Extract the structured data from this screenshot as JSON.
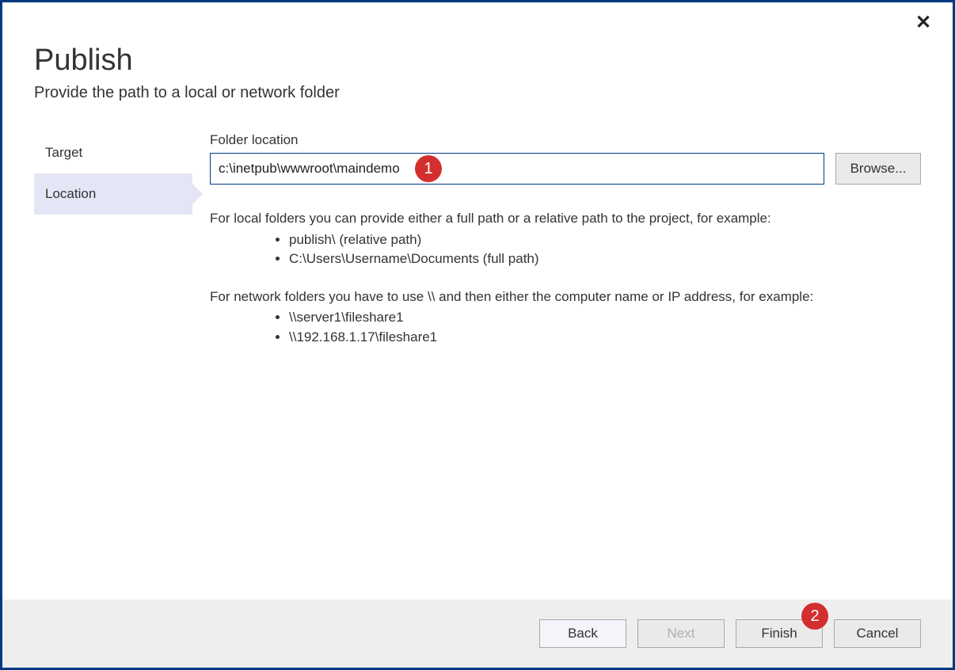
{
  "window": {
    "title": "Publish",
    "subtitle": "Provide the path to a local or network folder",
    "close_label": "✕"
  },
  "sidebar": {
    "items": [
      {
        "label": "Target",
        "selected": false
      },
      {
        "label": "Location",
        "selected": true
      }
    ]
  },
  "form": {
    "folder_label": "Folder location",
    "folder_value": "c:\\inetpub\\wwwroot\\maindemo",
    "browse_label": "Browse..."
  },
  "help": {
    "local_intro": "For local folders you can provide either a full path or a relative path to the project, for example:",
    "local_examples": [
      "publish\\ (relative path)",
      "C:\\Users\\Username\\Documents (full path)"
    ],
    "network_intro": "For network folders you have to use \\\\ and then either the computer name or IP address, for example:",
    "network_examples": [
      "\\\\server1\\fileshare1",
      "\\\\192.168.1.17\\fileshare1"
    ]
  },
  "footer": {
    "back": "Back",
    "next": "Next",
    "finish": "Finish",
    "cancel": "Cancel"
  },
  "callouts": {
    "one": "1",
    "two": "2"
  }
}
